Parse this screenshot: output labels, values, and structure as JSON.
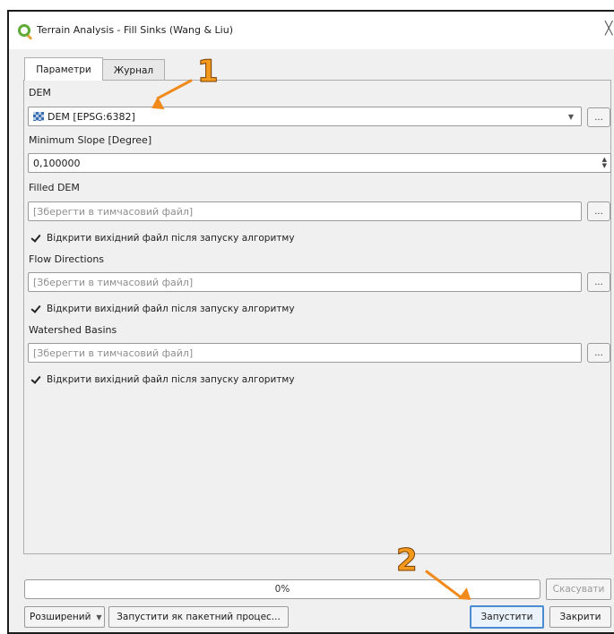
{
  "window": {
    "title": "Terrain Analysis - Fill Sinks (Wang & Liu)",
    "close_glyph": "╳"
  },
  "tabs": [
    {
      "label": "Параметри",
      "selected": true
    },
    {
      "label": "Журнал",
      "selected": false
    }
  ],
  "params": {
    "dem": {
      "label": "DEM",
      "value": "DEM [EPSG:6382]",
      "icon": "raster-layer-icon",
      "browse": "..."
    },
    "min_slope": {
      "label": "Minimum Slope [Degree]",
      "value": "0,100000"
    },
    "filled_dem": {
      "label": "Filled DEM",
      "placeholder": "[Зберегти в тимчасовий файл]",
      "browse": "...",
      "open_after": "Відкрити вихідний файл після запуску алгоритму",
      "open_after_checked": true
    },
    "flow_directions": {
      "label": "Flow Directions",
      "placeholder": "[Зберегти в тимчасовий файл]",
      "browse": "...",
      "open_after": "Відкрити вихідний файл після запуску алгоритму",
      "open_after_checked": true
    },
    "watershed_basins": {
      "label": "Watershed Basins",
      "placeholder": "[Зберегти в тимчасовий файл]",
      "browse": "...",
      "open_after": "Відкрити вихідний файл після запуску алгоритму",
      "open_after_checked": true
    }
  },
  "progress": {
    "value": 0,
    "text": "0%"
  },
  "buttons": {
    "cancel": "Скасувати",
    "advanced": "Розширений",
    "batch": "Запустити як пакетний процес...",
    "run": "Запустити",
    "close": "Закрити"
  },
  "annotations": [
    {
      "number": "1"
    },
    {
      "number": "2"
    }
  ],
  "colors": {
    "annotation": "#f08a1a",
    "run_focus": "#4a8bd1",
    "qgis_green": "#5eab36"
  }
}
